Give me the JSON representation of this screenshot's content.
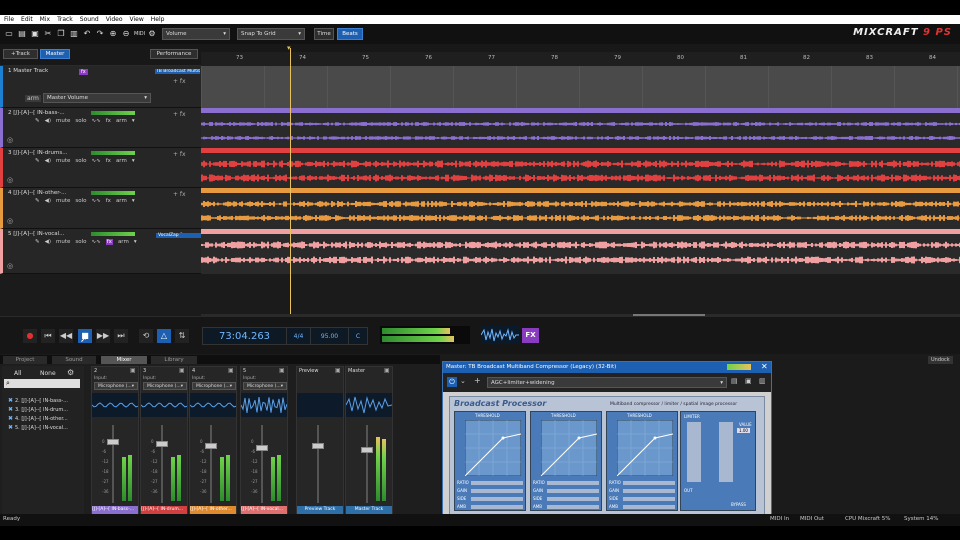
{
  "menu": [
    "File",
    "Edit",
    "Mix",
    "Track",
    "Sound",
    "Video",
    "View",
    "Help"
  ],
  "toolbar": {
    "volume_dropdown": "Volume",
    "snap_dropdown": "Snap To Grid",
    "time_button": "Time",
    "beats_button": "Beats",
    "logo_text": "MIXCRAFT",
    "logo_suffix": "9 PS"
  },
  "header": {
    "add_track": "+Track",
    "master_button": "Master",
    "performance_button": "Performance"
  },
  "ruler": {
    "ticks": [
      "73",
      "74",
      "75",
      "76",
      "77",
      "78",
      "79",
      "80",
      "81",
      "82",
      "83",
      "84"
    ]
  },
  "tracks": [
    {
      "name": "1 Master Track",
      "fx": "fx",
      "effect": "TB Broadcast Multib...",
      "fx_add": "+ fx",
      "automation": "Master Volume",
      "arm": "arm",
      "color": "#8a8a8a"
    },
    {
      "name": "2 [J]-[A]--[ IN-bass-...",
      "mute": "mute",
      "solo": "solo",
      "fx": "fx",
      "arm": "arm",
      "fx_add": "+ fx",
      "color": "#8a6fd0"
    },
    {
      "name": "3 [J]-[A]--[ IN-drums...",
      "mute": "mute",
      "solo": "solo",
      "fx": "fx",
      "arm": "arm",
      "fx_add": "+ fx",
      "color": "#e04040"
    },
    {
      "name": "4 [J]-[A]--[ IN-other-...",
      "mute": "mute",
      "solo": "solo",
      "fx": "fx",
      "arm": "arm",
      "fx_add": "+ fx",
      "color": "#e89a40"
    },
    {
      "name": "5 [J]-[A]--[ IN-vocal...",
      "mute": "mute",
      "solo": "solo",
      "fx": "fx",
      "arm": "arm",
      "effect": "VocalZap",
      "fx_add": "+ fx",
      "color": "#f0a0a0"
    }
  ],
  "transport": {
    "time": "73:04.263",
    "signature": "4/4",
    "tempo": "95.00",
    "key": "C",
    "fx_label": "FX"
  },
  "bottom_tabs": [
    "Project",
    "Sound",
    "Mixer",
    "Library"
  ],
  "undock": "Undock",
  "track_list": {
    "all": "All",
    "none": "None",
    "items": [
      "2. [J]-[A]--[ IN-bass-...",
      "3. [J]-[A]--[ IN-drum...",
      "4. [J]-[A]--[ IN-other...",
      "5. [J]-[A]--[ IN-vocal..."
    ]
  },
  "mixer": {
    "input_label": "Input:",
    "input_value": "Microphone (...",
    "strips": [
      {
        "num": "2",
        "label": "[J]-[A]--[ IN-bass-...",
        "color": "#8a6fd0"
      },
      {
        "num": "3",
        "label": "[J]-[A]--[ IN-drum...",
        "color": "#d04040"
      },
      {
        "num": "4",
        "label": "[J]-[A]--[ IN-other...",
        "color": "#e08a30"
      },
      {
        "num": "5",
        "label": "[J]-[A]--[ IN-vocal...",
        "color": "#e07070"
      }
    ],
    "preview": {
      "title": "Preview",
      "label": "Preview Track"
    },
    "master": {
      "title": "Master",
      "label": "Master Track"
    },
    "db_marks": [
      "0",
      "-6",
      "-12",
      "-18",
      "-27",
      "-36"
    ]
  },
  "plugin": {
    "title": "Master: TB Broadcast Multiband Compressor (Legacy) (32-Bit)",
    "preset": "AGC+limiter+widening",
    "brand": "Broadcast Processor",
    "subtitle": "Multiband compressor / limiter / spatial image processor",
    "band_label": "THRESHOLD",
    "ratio_label": "RATIO",
    "gain_label": "GAIN",
    "side_label": "SIDE",
    "amb_label": "AMB",
    "limiter_label": "LIMITER",
    "value_label": "VALUE",
    "value": "1.00",
    "out_label": "OUT",
    "bypass_label": "BYPASS"
  },
  "status": {
    "ready": "Ready",
    "midi_in": "MIDI In",
    "midi_out": "MIDI Out",
    "cpu": "CPU Mixcraft 5%",
    "system": "System 14%"
  }
}
